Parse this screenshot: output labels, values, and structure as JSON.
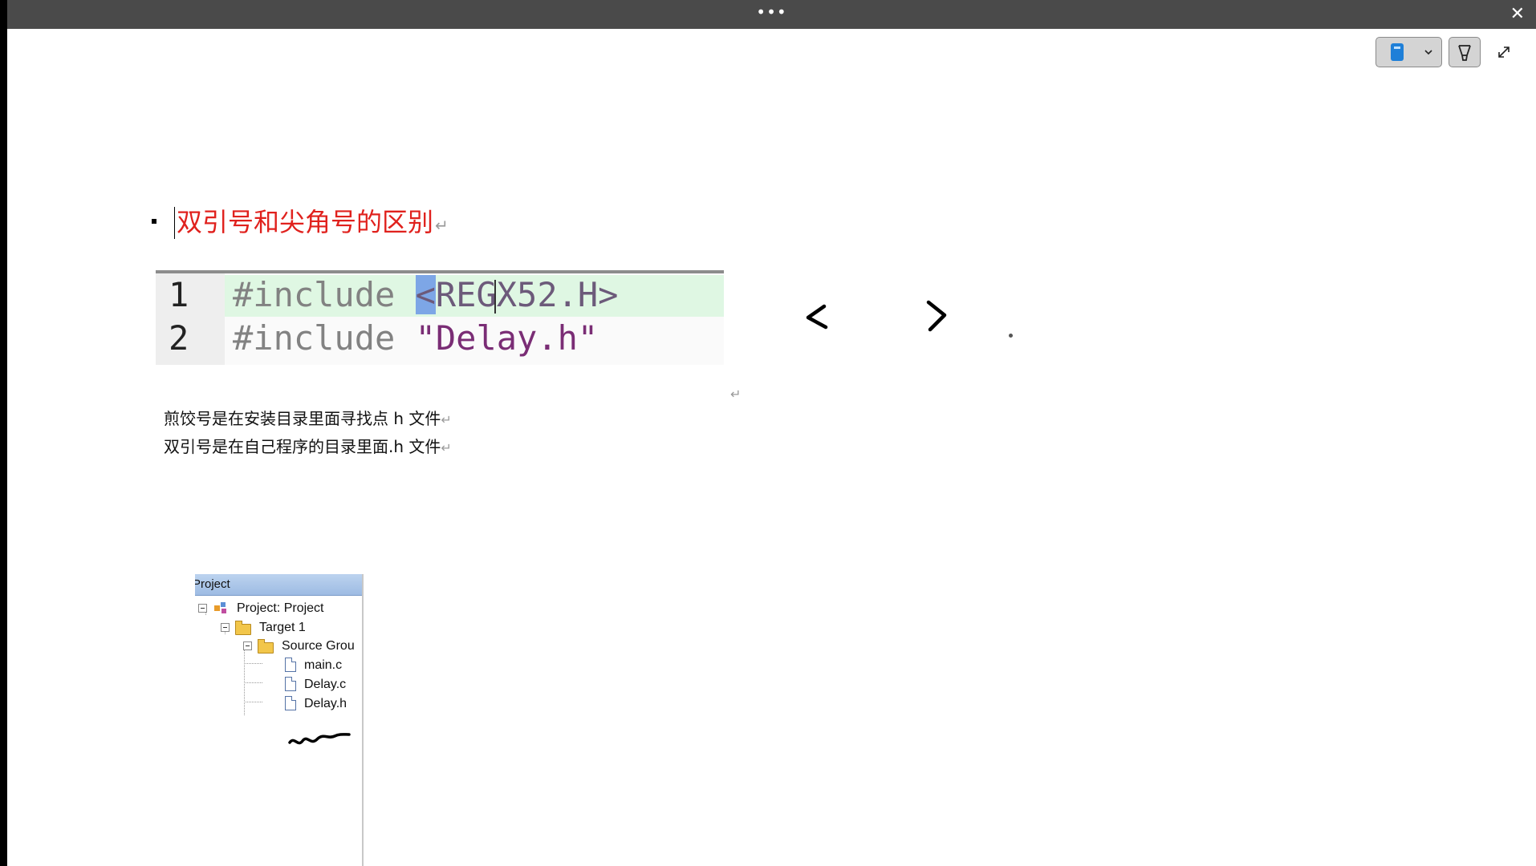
{
  "window": {
    "more_label": "•••",
    "close_label": "✕"
  },
  "toolbar": {
    "pen_color": "#1e7fd8",
    "pen_icon": "pen-icon",
    "pen_dropdown_icon": "chevron-down-icon",
    "eraser_icon": "eraser-icon",
    "expand_icon": "expand-icon"
  },
  "note": {
    "heading": "双引号和尖角号的区别",
    "heading_color": "#e0211d",
    "para_mark": "↵",
    "code_image": {
      "lines": [
        {
          "number": "1",
          "keyword": "#include",
          "selected": "<",
          "rest": "REGX52.H>"
        },
        {
          "number": "2",
          "keyword": "#include",
          "selected": "",
          "rest": "\"Delay.h\""
        }
      ]
    },
    "line1": "煎饺号是在安装目录里面寻找点 h 文件",
    "line2": "双引号是在自己程序的目录里面.h 文件",
    "ink_less_than": "<",
    "ink_greater_than": ">"
  },
  "project_panel": {
    "header": "Project",
    "tree": [
      {
        "label": "Project: Project",
        "icon": "project-icon"
      },
      {
        "label": "Target 1",
        "icon": "target-folder-icon"
      },
      {
        "label": "Source Grou",
        "icon": "folder-icon"
      },
      {
        "label": "main.c",
        "icon": "file-icon"
      },
      {
        "label": "Delay.c",
        "icon": "file-icon"
      },
      {
        "label": "Delay.h",
        "icon": "file-icon"
      }
    ]
  }
}
